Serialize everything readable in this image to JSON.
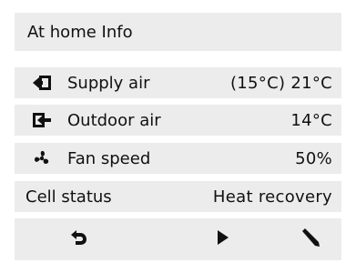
{
  "header": {
    "title": "At home Info"
  },
  "rows": [
    {
      "icon": "supply-air-icon",
      "label": "Supply air",
      "value": "(15°C) 21°C"
    },
    {
      "icon": "outdoor-air-icon",
      "label": "Outdoor air",
      "value": "14°C"
    },
    {
      "icon": "fan-icon",
      "label": "Fan speed",
      "value": "50%"
    },
    {
      "label": "Cell status",
      "value": "Heat recovery"
    }
  ],
  "footer": {
    "buttons": [
      "back-icon",
      "play-icon",
      "edit-icon"
    ]
  }
}
